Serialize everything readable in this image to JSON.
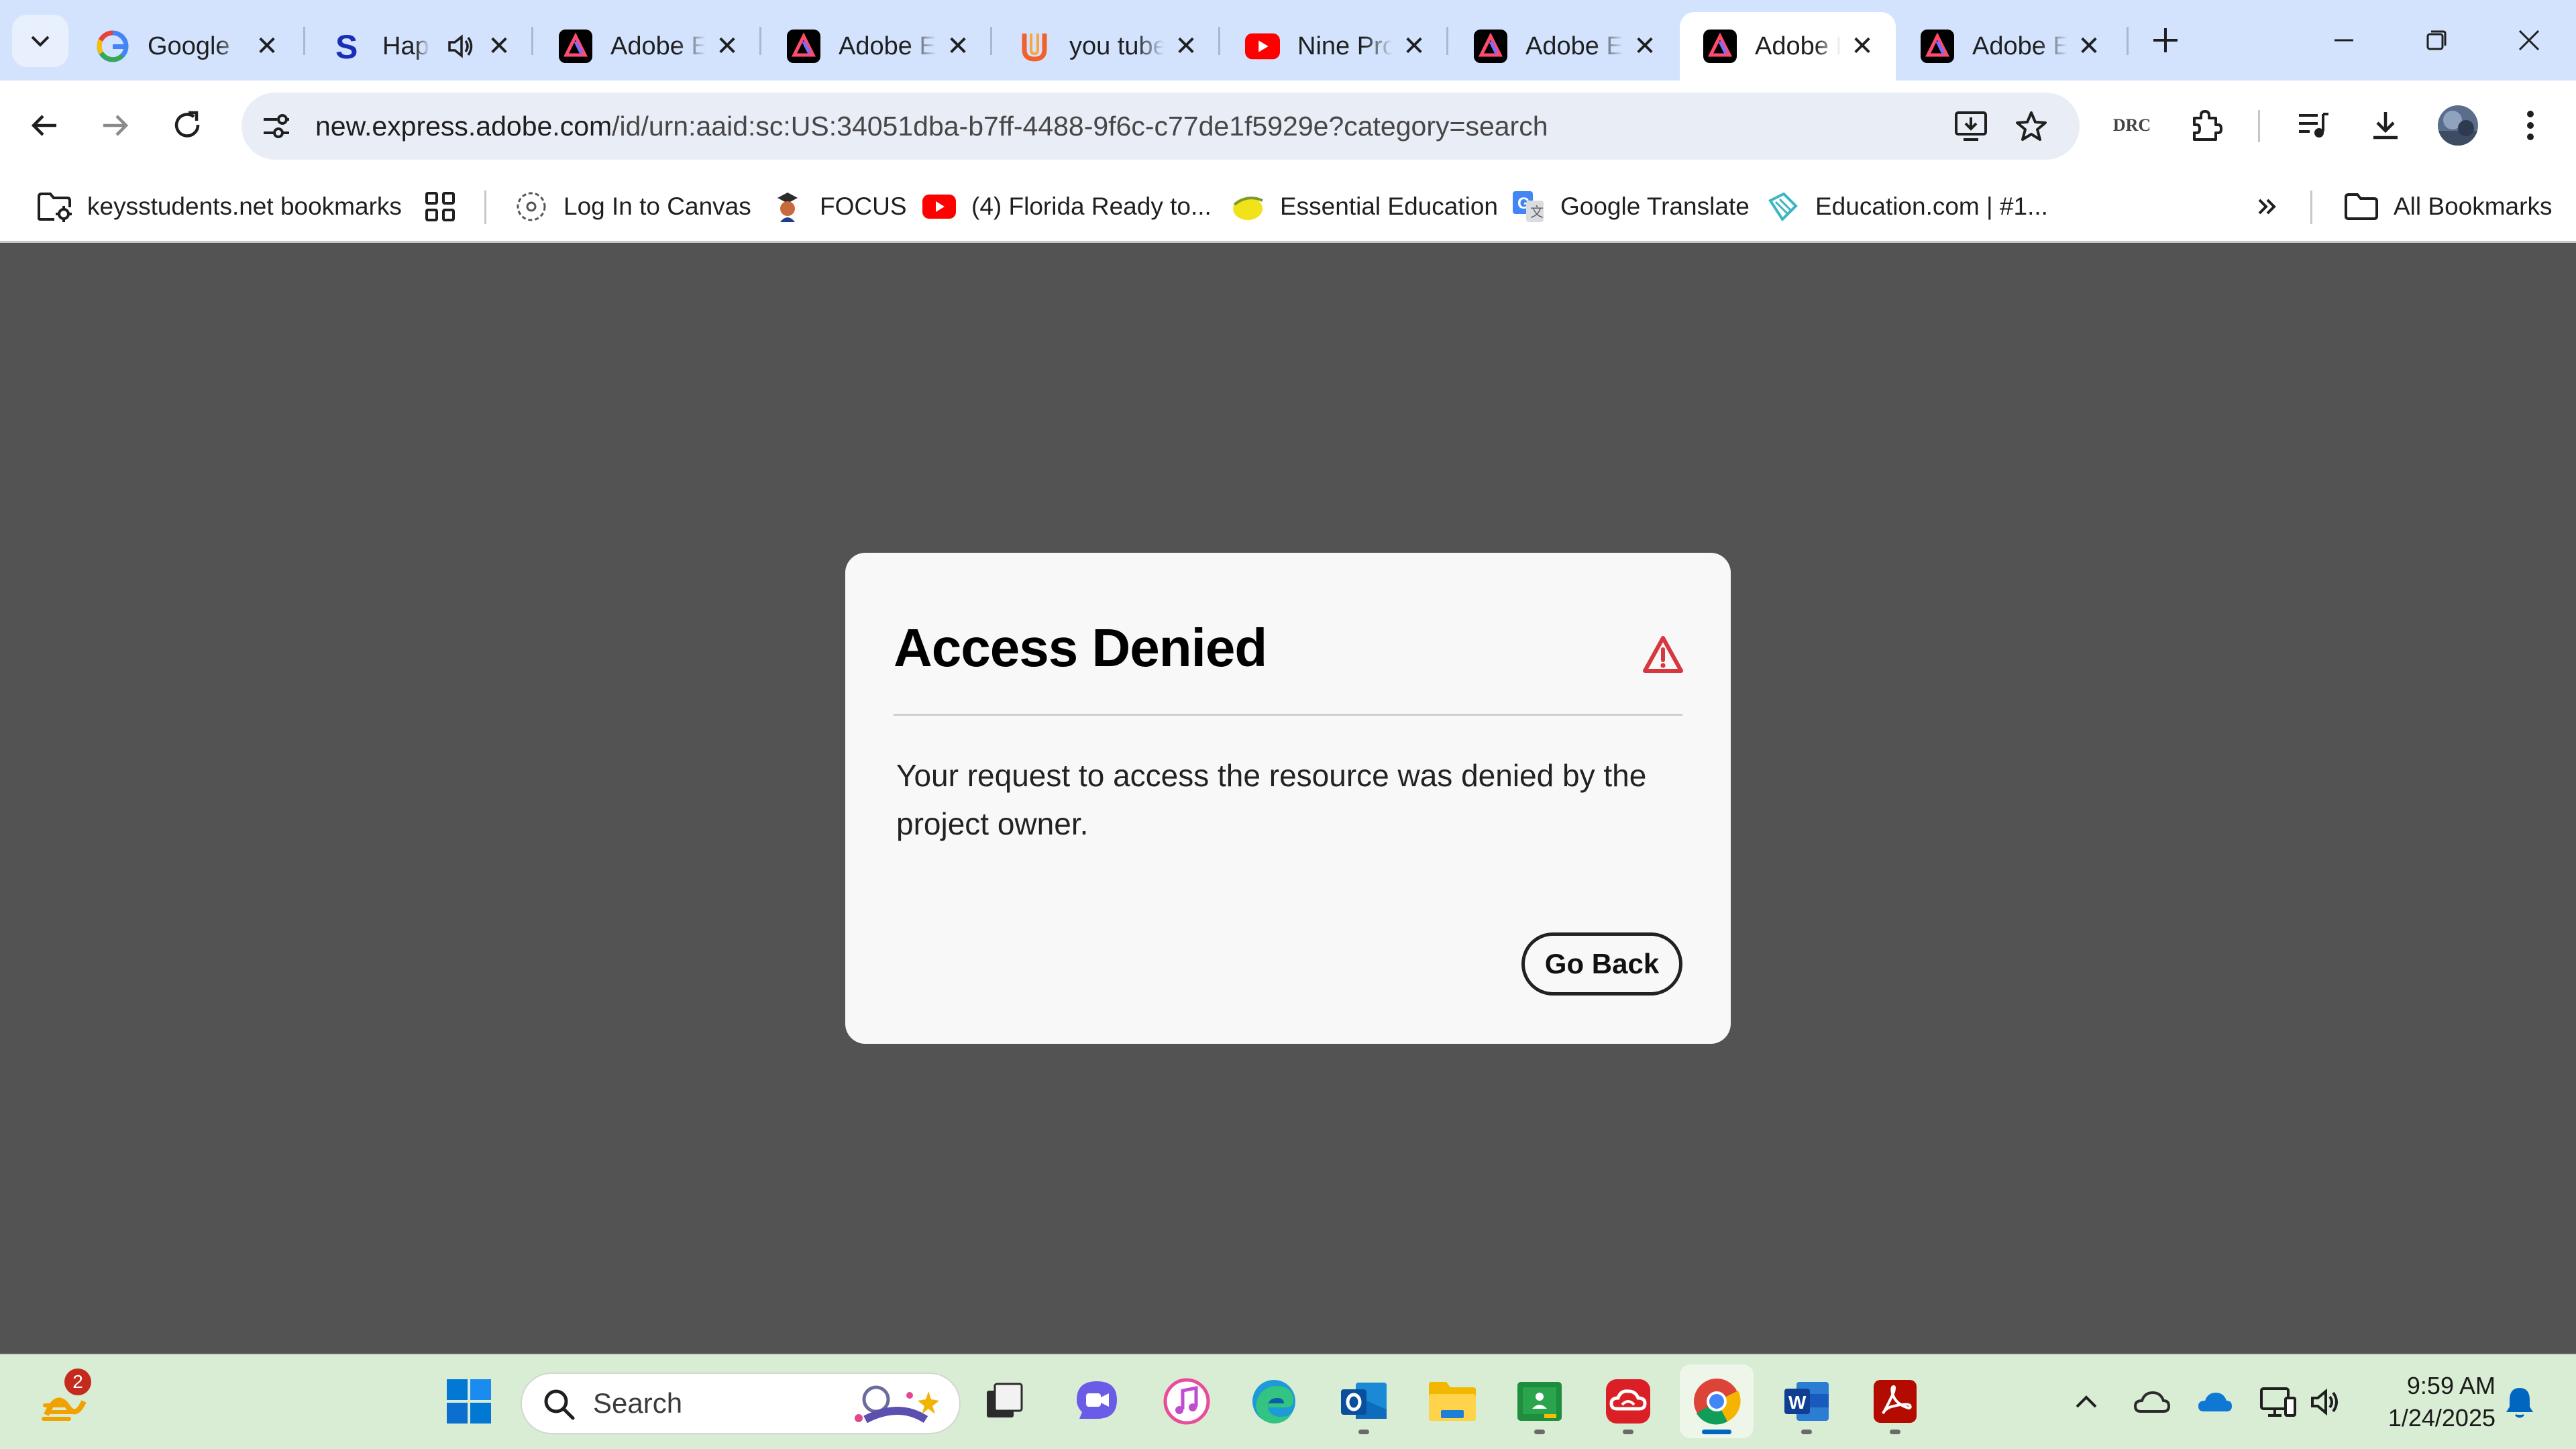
{
  "browser": {
    "tabs": [
      {
        "title": "Google",
        "favicon": "google-icon"
      },
      {
        "title": "Happy",
        "favicon": "s-logo-icon",
        "audio": true
      },
      {
        "title": "Adobe Express",
        "favicon": "adobe-express-icon"
      },
      {
        "title": "Adobe Express",
        "favicon": "adobe-express-icon"
      },
      {
        "title": "you tube",
        "favicon": "u-logo-icon"
      },
      {
        "title": "Nine Protect",
        "favicon": "youtube-icon"
      },
      {
        "title": "Adobe Express",
        "favicon": "adobe-express-icon"
      },
      {
        "title": "Adobe Express",
        "favicon": "adobe-express-icon",
        "active": true
      },
      {
        "title": "Adobe Express",
        "favicon": "adobe-express-icon"
      }
    ],
    "address_bar": {
      "host": "new.express.adobe.com",
      "path": "/id/urn:aaid:sc:US:34051dba-b7ff-4488-9f6c-c77de1f5929e?category=search"
    },
    "extension_label": "DRC",
    "bookmarks": [
      {
        "label": "keysstudents.net bookmarks",
        "icon": "folder-gear-icon"
      },
      {
        "label": "",
        "icon": "apps-grid-icon"
      },
      {
        "label": "Log In to Canvas",
        "icon": "canvas-icon"
      },
      {
        "label": "FOCUS",
        "icon": "focus-icon"
      },
      {
        "label": "(4) Florida Ready to...",
        "icon": "youtube-icon"
      },
      {
        "label": "Essential Education",
        "icon": "essential-education-icon"
      },
      {
        "label": "Google Translate",
        "icon": "google-translate-icon"
      },
      {
        "label": "Education.com | #1...",
        "icon": "education-com-icon"
      }
    ],
    "all_bookmarks_label": "All Bookmarks"
  },
  "dialog": {
    "title": "Access Denied",
    "message": "Your request to access the resource was denied by the project owner.",
    "button_label": "Go Back",
    "accent": "#d7373f"
  },
  "taskbar": {
    "widget_badge": "2",
    "search_placeholder": "Search",
    "apps": [
      "windows-start",
      "task-view",
      "teams",
      "itunes",
      "edge",
      "outlook",
      "file-explorer",
      "google-classroom",
      "creative-cloud",
      "chrome",
      "word",
      "acrobat"
    ],
    "clock": {
      "time": "9:59 AM",
      "date": "1/24/2025"
    }
  }
}
